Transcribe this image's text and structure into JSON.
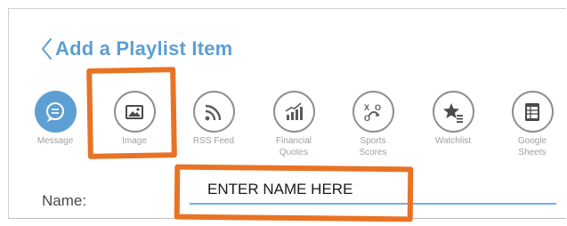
{
  "colors": {
    "accent": "#5d9fd2",
    "icon_gray": "#8e8e8e",
    "label_gray": "#a0a0a0",
    "annotation": "#e87325",
    "input_underline": "#7ab0df"
  },
  "header": {
    "back_icon": "chevron-left-icon",
    "title": "Add a Playlist Item"
  },
  "items": [
    {
      "label": "Message",
      "icon": "message-bubble-icon",
      "selected": true
    },
    {
      "label": "Image",
      "icon": "image-icon",
      "selected": false
    },
    {
      "label": "RSS Feed",
      "icon": "rss-icon",
      "selected": false
    },
    {
      "label": "Financial\nQuotes",
      "icon": "bar-chart-icon",
      "selected": false
    },
    {
      "label": "Sports\nScores",
      "icon": "sports-play-icon",
      "selected": false
    },
    {
      "label": "Watchlist",
      "icon": "star-list-icon",
      "selected": false
    },
    {
      "label": "Google\nSheets",
      "icon": "spreadsheet-icon",
      "selected": false
    }
  ],
  "form": {
    "name_label": "Name:",
    "name_value": "ENTER NAME HERE"
  }
}
